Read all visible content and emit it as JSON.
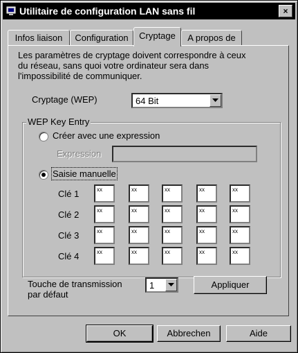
{
  "window": {
    "title": "Utilitaire de configuration LAN sans fil",
    "close_label": "×"
  },
  "tabs": [
    {
      "label": "Infos liaison",
      "active": false
    },
    {
      "label": "Configuration",
      "active": false
    },
    {
      "label": "Cryptage",
      "active": true
    },
    {
      "label": "A propos de",
      "active": false
    }
  ],
  "crypt": {
    "description_lines": [
      "Les paramètres de cryptage doivent correspondre à ceux",
      "du réseau, sans quoi votre ordinateur sera dans",
      "l'impossibilité de communiquer."
    ],
    "wep_label": "Cryptage (WEP)",
    "wep_value": "64 Bit"
  },
  "wep_entry": {
    "group_title": "WEP Key Entry",
    "radio_passphrase": "Créer avec une expression",
    "expression_label": "Expression",
    "expression_value": "",
    "radio_manual": "Saisie manuelle",
    "selected": "manual",
    "keys": [
      {
        "label": "Clé 1",
        "values": [
          "xx",
          "xx",
          "xx",
          "xx",
          "xx"
        ]
      },
      {
        "label": "Clé 2",
        "values": [
          "xx",
          "xx",
          "xx",
          "xx",
          "xx"
        ]
      },
      {
        "label": "Clé 3",
        "values": [
          "xx",
          "xx",
          "xx",
          "xx",
          "xx"
        ]
      },
      {
        "label": "Clé 4",
        "values": [
          "xx",
          "xx",
          "xx",
          "xx",
          "xx"
        ]
      }
    ]
  },
  "transmit": {
    "label_line1": "Touche de transmission",
    "label_line2": "par défaut",
    "value": "1",
    "apply_label": "Appliquer"
  },
  "footer": {
    "ok_label": "OK",
    "cancel_label": "Abbrechen",
    "help_label": "Aide"
  }
}
